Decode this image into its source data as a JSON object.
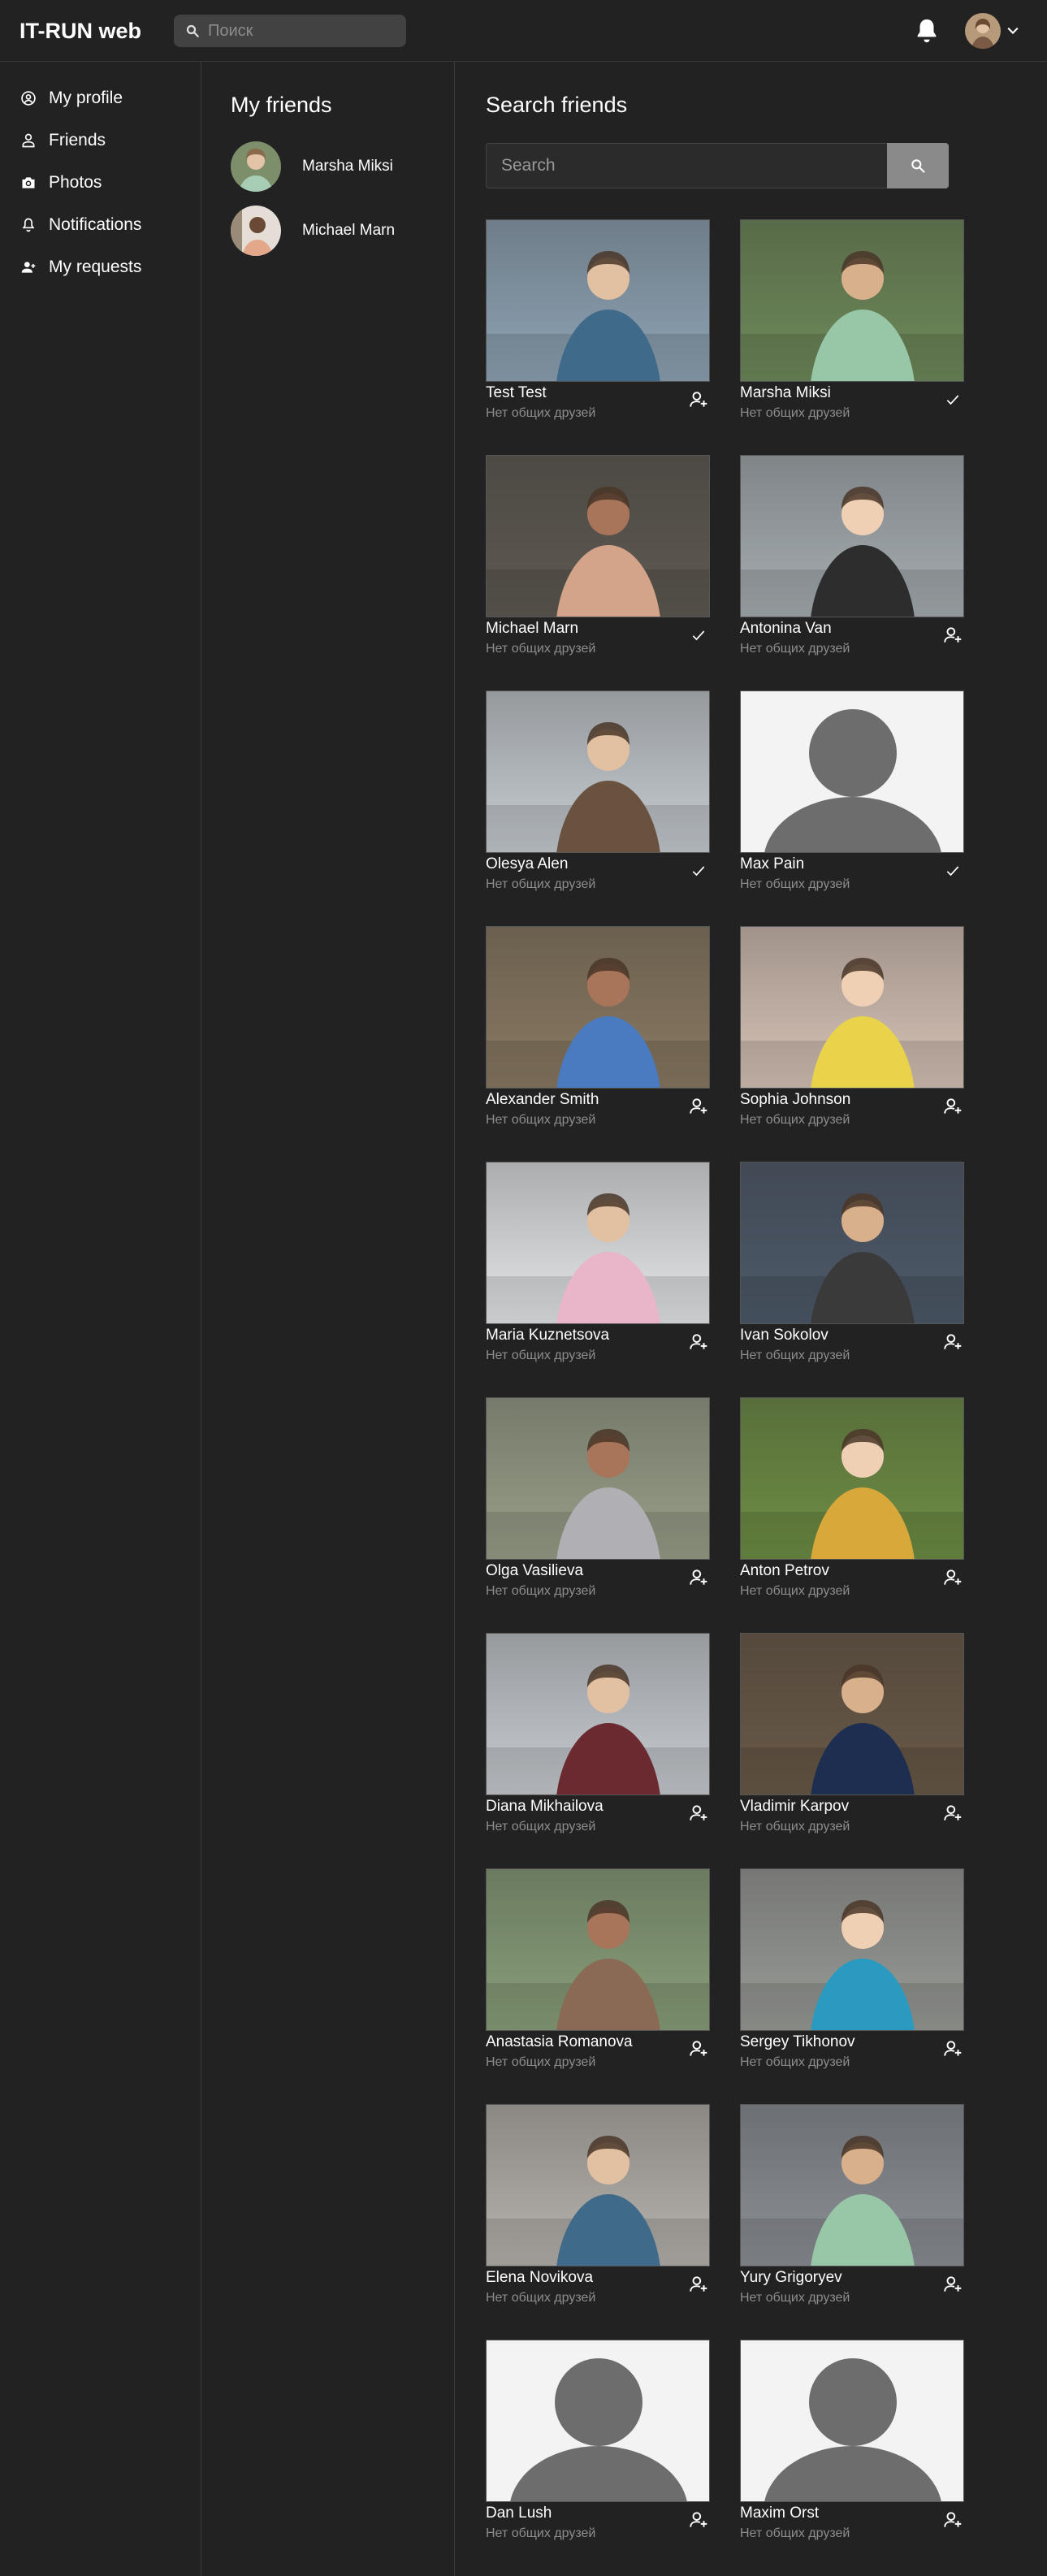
{
  "header": {
    "logo": "IT-RUN web",
    "search_placeholder": "Поиск"
  },
  "sidebar": {
    "items": [
      {
        "label": "My profile",
        "icon": "user-circle-icon"
      },
      {
        "label": "Friends",
        "icon": "users-icon"
      },
      {
        "label": "Photos",
        "icon": "camera-icon"
      },
      {
        "label": "Notifications",
        "icon": "bell-outline-icon"
      },
      {
        "label": "My requests",
        "icon": "user-plus-icon"
      }
    ]
  },
  "my_friends": {
    "title": "My friends",
    "list": [
      {
        "name": "Marsha Miksi"
      },
      {
        "name": "Michael Marn"
      }
    ]
  },
  "search_friends": {
    "title": "Search friends",
    "placeholder": "Search",
    "cards": [
      {
        "name": "Test Test",
        "subtitle": "Нет общих друзей",
        "action": "add-friend-icon",
        "bg": "#8fa4b5"
      },
      {
        "name": "Marsha Miksi",
        "subtitle": "Нет общих друзей",
        "action": "check-icon",
        "bg": "#6f8a5a"
      },
      {
        "name": "Michael Marn",
        "subtitle": "Нет общих друзей",
        "action": "check-icon",
        "bg": "#5f5a52"
      },
      {
        "name": "Antonina Van",
        "subtitle": "Нет общих друзей",
        "action": "add-friend-icon",
        "bg": "#a7afb3"
      },
      {
        "name": "Olesya Alen",
        "subtitle": "Нет общих друзей",
        "action": "check-icon",
        "bg": "#c7cdd2"
      },
      {
        "name": "Max Pain",
        "subtitle": "Нет общих друзей",
        "action": "check-icon",
        "bg": "#f3f3f3"
      },
      {
        "name": "Alexander Smith",
        "subtitle": "Нет общих друзей",
        "action": "add-friend-icon",
        "bg": "#8a7a62"
      },
      {
        "name": "Sophia Johnson",
        "subtitle": "Нет общих друзей",
        "action": "add-friend-icon",
        "bg": "#d8c4b8"
      },
      {
        "name": "Maria Kuznetsova",
        "subtitle": "Нет общих друзей",
        "action": "add-friend-icon",
        "bg": "#e6e8ea"
      },
      {
        "name": "Ivan Sokolov",
        "subtitle": "Нет общих друзей",
        "action": "add-friend-icon",
        "bg": "#4e5a6a"
      },
      {
        "name": "Olga Vasilieva",
        "subtitle": "Нет общих друзей",
        "action": "add-friend-icon",
        "bg": "#9aa08a"
      },
      {
        "name": "Anton Petrov",
        "subtitle": "Нет общих друзей",
        "action": "add-friend-icon",
        "bg": "#6f8f45"
      },
      {
        "name": "Diana Mikhailova",
        "subtitle": "Нет общих друзей",
        "action": "add-friend-icon",
        "bg": "#c9cdd2"
      },
      {
        "name": "Vladimir Karpov",
        "subtitle": "Нет общих друзей",
        "action": "add-friend-icon",
        "bg": "#6a5a48"
      },
      {
        "name": "Anastasia Romanova",
        "subtitle": "Нет общих друзей",
        "action": "add-friend-icon",
        "bg": "#8aa07a"
      },
      {
        "name": "Sergey Tikhonov",
        "subtitle": "Нет общих друзей",
        "action": "add-friend-icon",
        "bg": "#9a9c98"
      },
      {
        "name": "Elena Novikova",
        "subtitle": "Нет общих друзей",
        "action": "add-friend-icon",
        "bg": "#b8b4ae"
      },
      {
        "name": "Yury Grigoryev",
        "subtitle": "Нет общих друзей",
        "action": "add-friend-icon",
        "bg": "#8c9096"
      },
      {
        "name": "Dan Lush",
        "subtitle": "Нет общих друзей",
        "action": "add-friend-icon",
        "bg": "#f3f3f3"
      },
      {
        "name": "Maxim Orst",
        "subtitle": "Нет общих друзей",
        "action": "add-friend-icon",
        "bg": "#f3f3f3"
      }
    ]
  }
}
